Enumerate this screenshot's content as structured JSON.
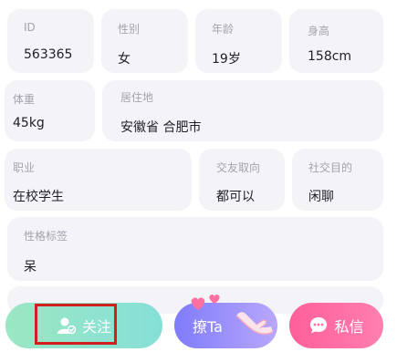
{
  "profile": {
    "id_label": "ID",
    "id_value": "563365",
    "gender_label": "性别",
    "gender_value": "女",
    "age_label": "年龄",
    "age_value": "19岁",
    "height_label": "身高",
    "height_value": "158cm",
    "weight_label": "体重",
    "weight_value": "45kg",
    "residence_label": "居住地",
    "residence_value": "安徽省 合肥市",
    "job_label": "职业",
    "job_value": "在校学生",
    "orientation_label": "交友取向",
    "orientation_value": "都可以",
    "purpose_label": "社交目的",
    "purpose_value": "闲聊",
    "personality_label": "性格标签",
    "personality_value": "呆"
  },
  "actions": {
    "follow_label": "关注",
    "flirt_label": "撩Ta",
    "message_label": "私信"
  },
  "colors": {
    "card_bg": "#f4f4f8",
    "follow_gradient": [
      "#9be7c3",
      "#86dfd7"
    ],
    "flirt_gradient": [
      "#7f7cfb",
      "#b9a7fb"
    ],
    "message_gradient": [
      "#ff5f99",
      "#ff7fb0"
    ],
    "highlight": "#d11f1f"
  },
  "icons": {
    "follow": "user-follow-icon",
    "flirt_deco": "hearts-hand-icon",
    "message": "chat-bubble-icon"
  }
}
